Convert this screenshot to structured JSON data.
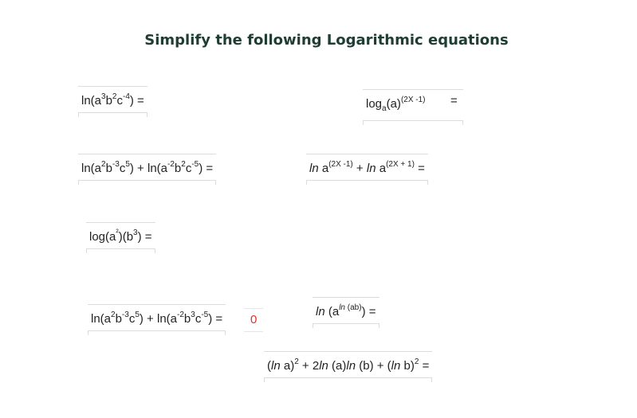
{
  "title": "Simplify the following Logarithmic equations",
  "equations": [
    {
      "id": "eq1",
      "text": "ln(a³b²c⁻⁴) ="
    },
    {
      "id": "eq2",
      "text": "log_a(a)^(2X -1) ="
    },
    {
      "id": "eq3",
      "text": "ln(a²b⁻³c⁵) + ln(a⁻²b²c⁻⁵) ="
    },
    {
      "id": "eq4",
      "text": "ln a^(2X -1) + ln a^(2X + 1) ="
    },
    {
      "id": "eq5",
      "text": "log(a²)(b³) ="
    },
    {
      "id": "eq6",
      "text": "ln(a²b⁻³c⁵) + ln(a⁻²b³c⁻⁵) ="
    },
    {
      "id": "eq7",
      "text": "ln (a^(ln (ab))) ="
    },
    {
      "id": "eq8",
      "text": "(ln a)² + 2ln (a)ln (b) + (ln b)² ="
    }
  ],
  "answers": {
    "eq6": "0"
  }
}
